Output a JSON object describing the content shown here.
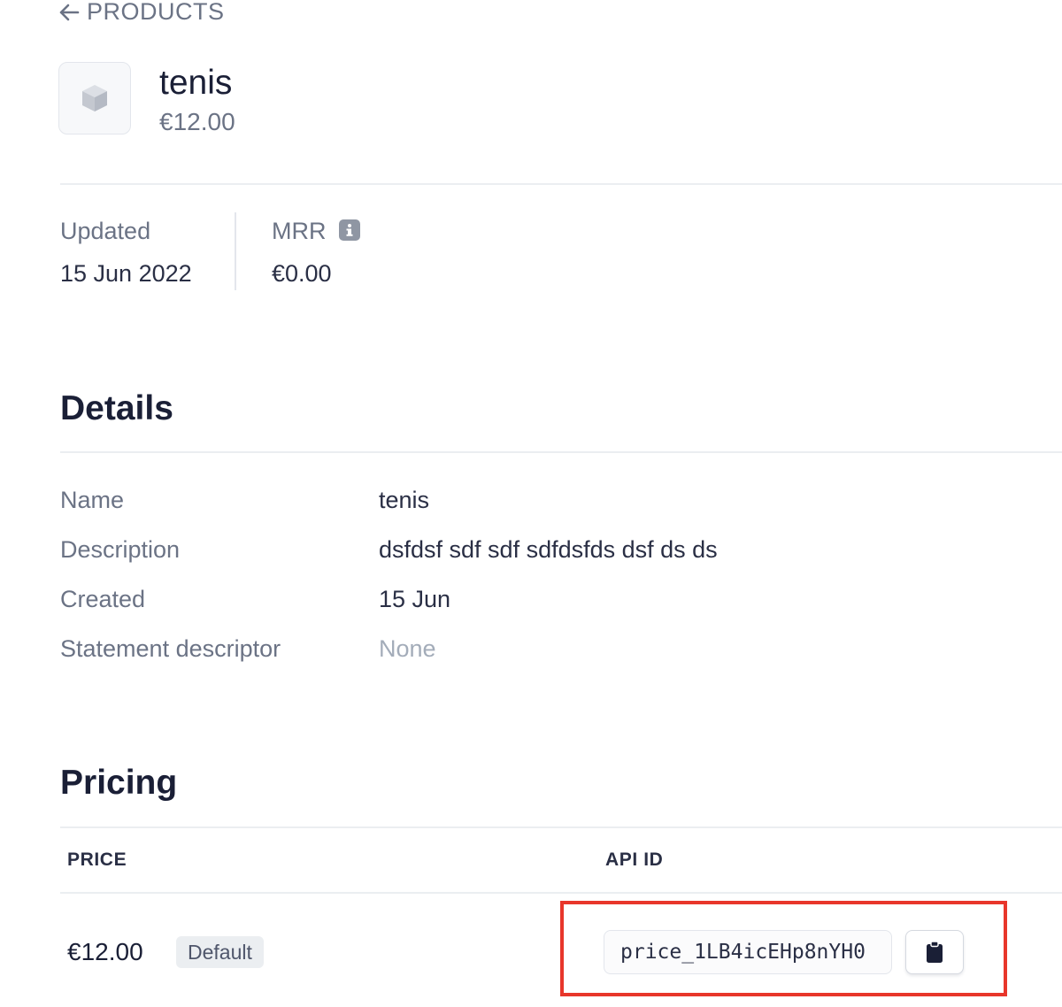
{
  "nav": {
    "back_label": "PRODUCTS"
  },
  "product": {
    "name": "tenis",
    "price": "€12.00",
    "thumbnail_icon": "box-icon"
  },
  "stats": {
    "updated": {
      "label": "Updated",
      "value": "15 Jun 2022"
    },
    "mrr": {
      "label": "MRR",
      "value": "€0.00",
      "info_icon": "info-icon"
    }
  },
  "details": {
    "title": "Details",
    "rows": [
      {
        "label": "Name",
        "value": "tenis"
      },
      {
        "label": "Description",
        "value": "dsfdsf sdf sdf sdfdsfds dsf ds ds"
      },
      {
        "label": "Created",
        "value": "15 Jun"
      },
      {
        "label": "Statement descriptor",
        "value": "None"
      }
    ]
  },
  "pricing": {
    "title": "Pricing",
    "columns": [
      "PRICE",
      "API ID"
    ],
    "rows": [
      {
        "price": "€12.00",
        "badge": "Default",
        "api_id": "price_1LB4icEHp8nYH0",
        "copy_icon": "clipboard-icon"
      }
    ],
    "highlight_color": "#e8362b"
  }
}
